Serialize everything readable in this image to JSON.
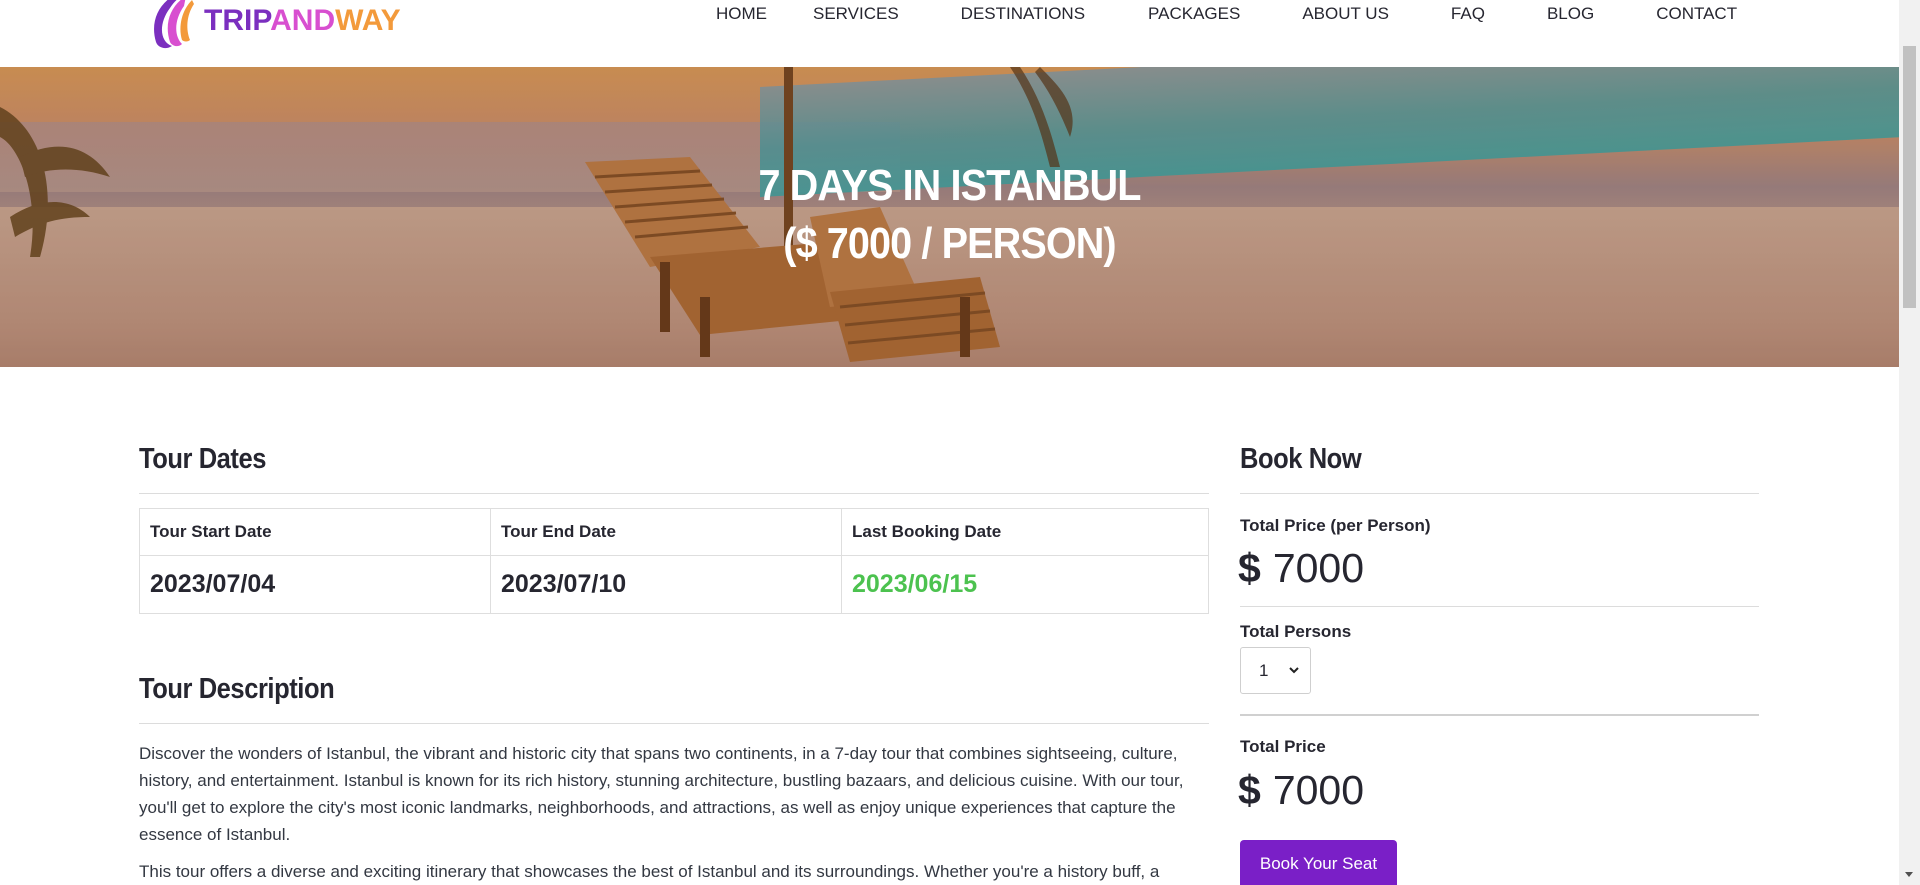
{
  "brand": {
    "name_part1": "TRIP",
    "name_part2": "AND",
    "name_part3": "WAY",
    "colors": {
      "purple": "#7b2fbf",
      "pink": "#d84fd0",
      "orange": "#f39a3b"
    }
  },
  "nav": {
    "items": [
      "HOME",
      "SERVICES",
      "DESTINATIONS",
      "PACKAGES",
      "ABOUT US",
      "FAQ",
      "BLOG",
      "CONTACT"
    ]
  },
  "hero": {
    "title_line1": "7 DAYS IN ISTANBUL",
    "title_line2": "($ 7000 / PERSON)"
  },
  "tour_dates": {
    "heading": "Tour Dates",
    "columns": [
      "Tour Start Date",
      "Tour End Date",
      "Last Booking Date"
    ],
    "values": [
      "2023/07/04",
      "2023/07/10",
      "2023/06/15"
    ],
    "last_booking_color": "#4cc24f"
  },
  "tour_description": {
    "heading": "Tour Description",
    "paragraphs": [
      "Discover the wonders of Istanbul, the vibrant and historic city that spans two continents, in a 7-day tour that combines sightseeing, culture, history, and entertainment. Istanbul is known for its rich history, stunning architecture, bustling bazaars, and delicious cuisine. With our tour, you'll get to explore the city's most iconic landmarks, neighborhoods, and attractions, as well as enjoy unique experiences that capture the essence of Istanbul.",
      "This tour offers a diverse and exciting itinerary that showcases the best of Istanbul and its surroundings. Whether you're a history buff, a"
    ]
  },
  "booking": {
    "heading": "Book Now",
    "price_per_person_label": "Total Price (per Person)",
    "currency_symbol": "$",
    "price_per_person": "7000",
    "persons_label": "Total Persons",
    "persons_selected": "1",
    "total_label": "Total Price",
    "total_price": "7000",
    "button_label": "Book Your Seat",
    "button_color": "#7a1fc7"
  }
}
